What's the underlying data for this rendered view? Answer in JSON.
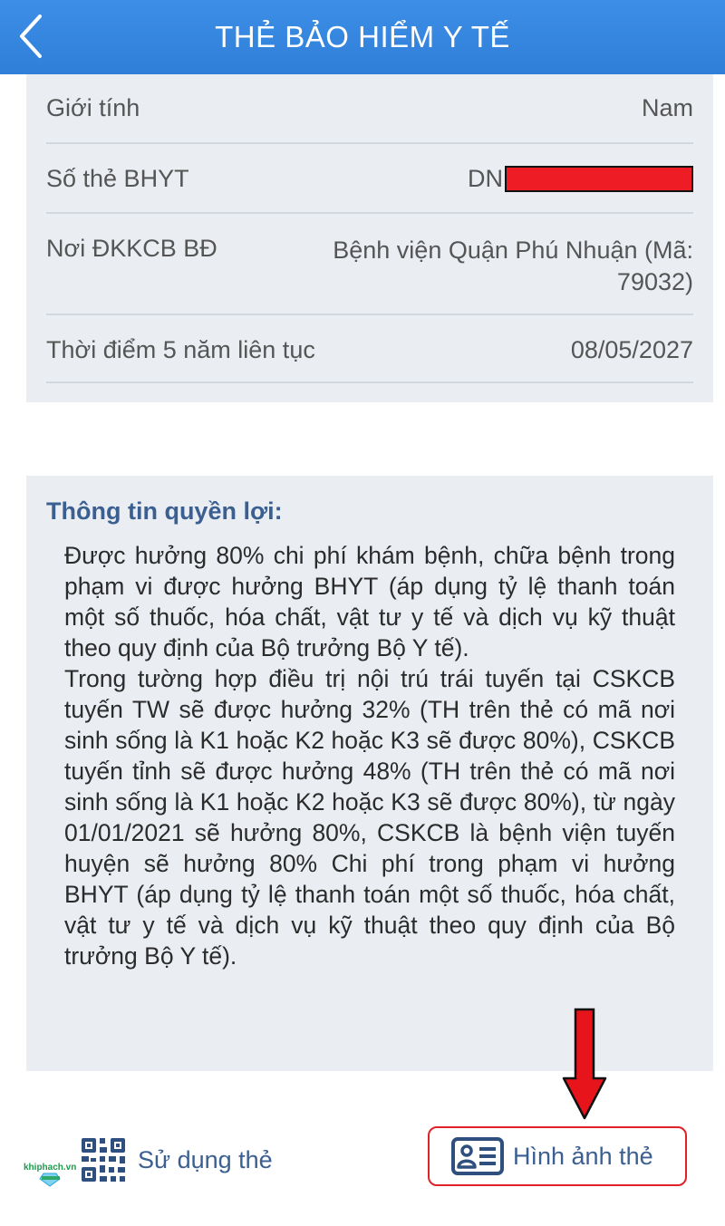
{
  "header": {
    "title": "THẺ BẢO HIỂM Y TẾ"
  },
  "info": {
    "gender_label": "Giới tính",
    "gender_value": "Nam",
    "card_label": "Số thẻ BHYT",
    "card_prefix": "DN",
    "place_label": "Nơi ĐKKCB BĐ",
    "place_value": "Bệnh viện Quận Phú Nhuận (Mã: 79032)",
    "five_year_label": "Thời điểm 5 năm liên tục",
    "five_year_value": "08/05/2027"
  },
  "benefits": {
    "title": "Thông tin quyền lợi:",
    "paragraph1": "Được hưởng 80% chi phí khám bệnh, chữa bệnh trong phạm vi được hưởng BHYT (áp dụng tỷ lệ thanh toán một số thuốc, hóa chất, vật tư y tế và dịch vụ kỹ thuật theo quy định của Bộ trưởng Bộ Y tế).",
    "paragraph2": "Trong tường hợp điều trị nội trú trái tuyến tại CSKCB tuyến TW sẽ được hưởng 32% (TH trên thẻ có mã nơi sinh sống là K1 hoặc K2 hoặc K3 sẽ được 80%), CSKCB tuyến tỉnh sẽ được hưởng 48% (TH trên thẻ có mã nơi sinh sống là K1 hoặc K2 hoặc K3 sẽ được 80%), từ ngày 01/01/2021 sẽ hưởng 80%, CSKCB là bệnh viện tuyến huyện sẽ hưởng 80% Chi phí trong phạm vi hưởng BHYT (áp dụng tỷ lệ thanh toán một số thuốc, hóa chất, vật tư y tế và dịch vụ kỹ thuật theo quy định của Bộ trưởng Bộ Y tế)."
  },
  "bottom": {
    "use_card_label": "Sử dụng thẻ",
    "card_image_label": "Hình ảnh  thẻ",
    "watermark": "khiphach.vn"
  },
  "colors": {
    "header": "#2f7fd9",
    "accent_text": "#3b5f91",
    "card_bg": "#eaeef3",
    "highlight_red": "#e02228"
  },
  "icons": [
    "back-chevron-icon",
    "qr-code-icon",
    "id-card-icon",
    "down-arrow-annotation"
  ]
}
